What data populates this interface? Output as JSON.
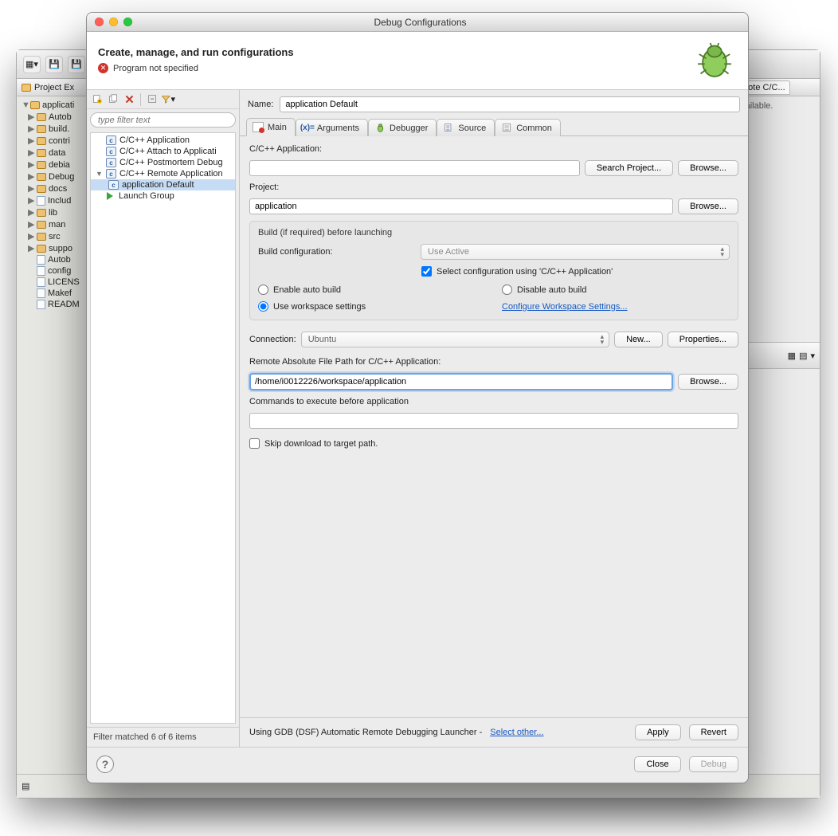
{
  "window": {
    "title": "Debug Configurations"
  },
  "header": {
    "title": "Create, manage, and run configurations",
    "error": "Program not specified"
  },
  "nav": {
    "filter_placeholder": "type filter text",
    "items": [
      {
        "label": "C/C++ Application"
      },
      {
        "label": "C/C++ Attach to Applicati"
      },
      {
        "label": "C/C++ Postmortem Debug"
      },
      {
        "label": "C/C++ Remote Application",
        "expanded": true,
        "children": [
          {
            "label": "application Default",
            "selected": true
          }
        ]
      },
      {
        "label": "Launch Group",
        "icon": "play"
      }
    ],
    "status": "Filter matched 6 of 6 items"
  },
  "name": {
    "label": "Name:",
    "value": "application Default"
  },
  "tabs": {
    "main": "Main",
    "arguments": "Arguments",
    "debugger": "Debugger",
    "source": "Source",
    "common": "Common"
  },
  "main_tab": {
    "app_label": "C/C++ Application:",
    "app_value": "",
    "search_project_btn": "Search Project...",
    "browse_btn": "Browse...",
    "project_label": "Project:",
    "project_value": "application",
    "build_group_title": "Build (if required) before launching",
    "build_cfg_label": "Build configuration:",
    "build_cfg_value": "Use Active",
    "select_cfg_check": "Select configuration using 'C/C++ Application'",
    "enable_auto_build": "Enable auto build",
    "disable_auto_build": "Disable auto build",
    "use_ws_settings": "Use workspace settings",
    "configure_ws_link": "Configure Workspace Settings...",
    "conn_label": "Connection:",
    "conn_value": "Ubuntu",
    "new_btn": "New...",
    "properties_btn": "Properties...",
    "remote_path_label": "Remote Absolute File Path for C/C++ Application:",
    "remote_path_value": "/home/i0012226/workspace/application",
    "cmds_label": "Commands to execute before application",
    "cmds_value": "",
    "skip_dl_label": "Skip download to target path."
  },
  "launcher_row": {
    "text": "Using GDB (DSF) Automatic Remote Debugging Launcher - ",
    "select_other": "Select other...",
    "apply": "Apply",
    "revert": "Revert"
  },
  "footer": {
    "close": "Close",
    "debug": "Debug"
  },
  "bg": {
    "project_explorer": "Project Ex",
    "remote_tab": "mote C/C...",
    "available": "available.",
    "tree": [
      "applicati",
      "Autob",
      "build.",
      "contri",
      "data",
      "debia",
      "Debug",
      "docs",
      "Includ",
      "lib",
      "man",
      "src",
      "suppo",
      "Autob",
      "config",
      "LICENS",
      "Makef",
      "READM"
    ]
  }
}
